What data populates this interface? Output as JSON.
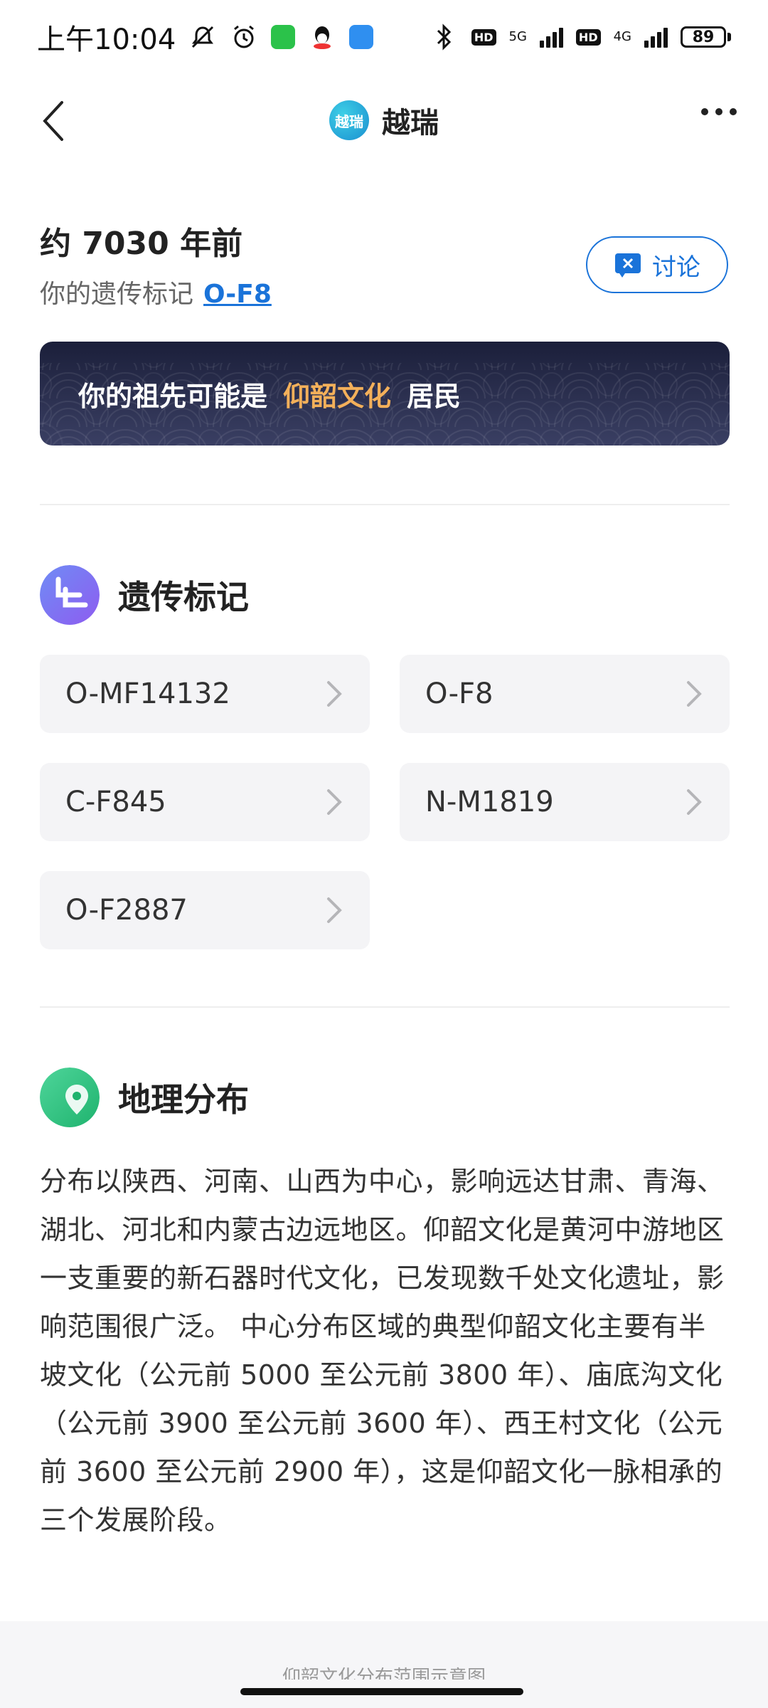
{
  "status_bar": {
    "time": "上午10:04",
    "net1": "5G",
    "net2": "4G",
    "hd": "HD",
    "battery": "89"
  },
  "nav": {
    "logo_text": "越瑞",
    "title": "越瑞"
  },
  "header": {
    "era": "约 7030 年前",
    "marker_label": "你的遗传标记",
    "marker_link": "O-F8",
    "discuss_label": "讨论"
  },
  "banner": {
    "prefix": "你的祖先可能是",
    "culture": "仰韶文化",
    "suffix": "居民"
  },
  "markers_section": {
    "title": "遗传标记",
    "items": [
      {
        "label": "O-MF14132"
      },
      {
        "label": "O-F8"
      },
      {
        "label": "C-F845"
      },
      {
        "label": "N-M1819"
      },
      {
        "label": "O-F2887"
      }
    ]
  },
  "geo_section": {
    "title": "地理分布",
    "text": "分布以陕西、河南、山西为中心，影响远达甘肃、青海、湖北、河北和内蒙古边远地区。仰韶文化是黄河中游地区一支重要的新石器时代文化，已发现数千处文化遗址，影响范围很广泛。 中心分布区域的典型仰韶文化主要有半坡文化（公元前 5000 至公元前 3800 年）、庙底沟文化（公元前 3900 至公元前 3600 年）、西王村文化（公元前 3600 至公元前 2900 年），这是仰韶文化一脉相承的三个发展阶段。",
    "map_caption": "仰韶文化分布范围示意图"
  },
  "colors": {
    "accent": "#1a73d9",
    "banner_highlight": "#f3b05a",
    "banner_bg": "#1b1f3a"
  }
}
